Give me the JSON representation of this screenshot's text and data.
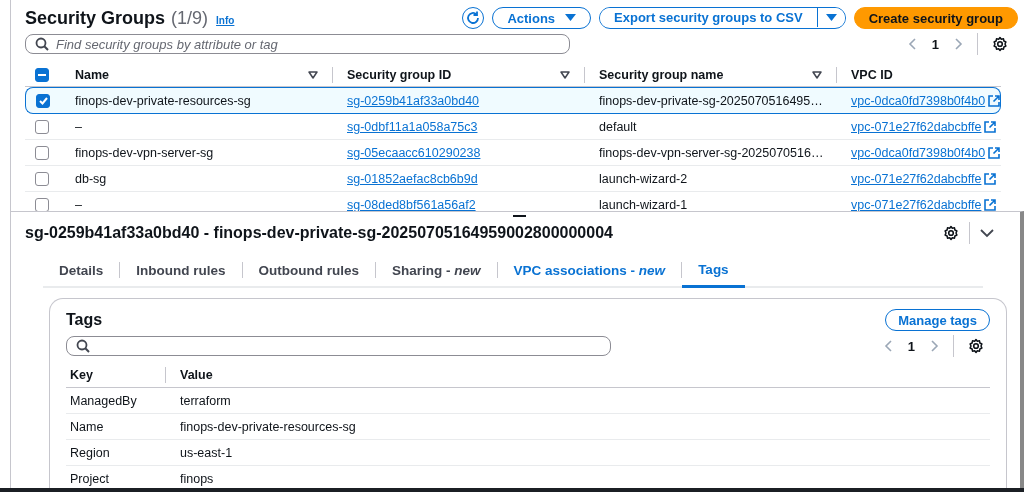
{
  "list": {
    "title": "Security Groups",
    "count": "(1/9)",
    "info": "Info",
    "actions": [
      {
        "kind": "refresh"
      },
      {
        "kind": "dropdown",
        "label": "Actions"
      },
      {
        "kind": "split",
        "label": "Export security groups to CSV"
      },
      {
        "kind": "primary",
        "label": "Create security group"
      }
    ],
    "search": {
      "placeholder": "Find security groups by attribute or tag"
    },
    "page": "1",
    "select_all": {
      "indeterminate": true
    },
    "columns": [
      {
        "label": "Name",
        "sortable": true
      },
      {
        "label": "Security group ID",
        "sortable": true
      },
      {
        "label": "Security group name",
        "sortable": true
      },
      {
        "label": "VPC ID",
        "sortable": false
      }
    ],
    "rows": [
      {
        "selected": true,
        "name": "finops-dev-private-resources-sg",
        "group_id": "sg-0259b41af33a0bd40",
        "group_name": "finops-dev-private-sg-2025070516495…",
        "vpc_id": "vpc-0dca0fd7398b0f4b0"
      },
      {
        "selected": false,
        "name": "–",
        "group_id": "sg-0dbf11a1a058a75c3",
        "group_name": "default",
        "vpc_id": "vpc-071e27f62dabcbffe"
      },
      {
        "selected": false,
        "name": "finops-dev-vpn-server-sg",
        "group_id": "sg-05ecaacc610290238",
        "group_name": "finops-dev-vpn-server-sg-2025070516…",
        "vpc_id": "vpc-0dca0fd7398b0f4b0"
      },
      {
        "selected": false,
        "name": "db-sg",
        "group_id": "sg-01852aefac8cb6b9d",
        "group_name": "launch-wizard-2",
        "vpc_id": "vpc-071e27f62dabcbffe"
      },
      {
        "selected": false,
        "name": "–",
        "group_id": "sg-08ded8bf561a56af2",
        "group_name": "launch-wizard-1",
        "vpc_id": "vpc-071e27f62dabcbffe"
      }
    ]
  },
  "detail": {
    "title": "sg-0259b41af33a0bd40 - finops-dev-private-sg-20250705164959002800000004",
    "tabs": [
      {
        "label": "Details",
        "selected": false
      },
      {
        "label": "Inbound rules",
        "selected": false
      },
      {
        "label": "Outbound rules",
        "selected": false
      },
      {
        "label": "Sharing - *new*",
        "selected": false
      },
      {
        "label": "VPC associations - *new*",
        "selected": false
      },
      {
        "label": "Tags",
        "selected": true
      }
    ],
    "tags": {
      "title": "Tags",
      "button": "Manage tags",
      "page": "1",
      "columns": [
        "Key",
        "Value"
      ],
      "rows": [
        {
          "key": "ManagedBy",
          "value": "terraform"
        },
        {
          "key": "Name",
          "value": "finops-dev-private-resources-sg"
        },
        {
          "key": "Region",
          "value": "us-east-1"
        },
        {
          "key": "Project",
          "value": "finops"
        }
      ]
    }
  }
}
